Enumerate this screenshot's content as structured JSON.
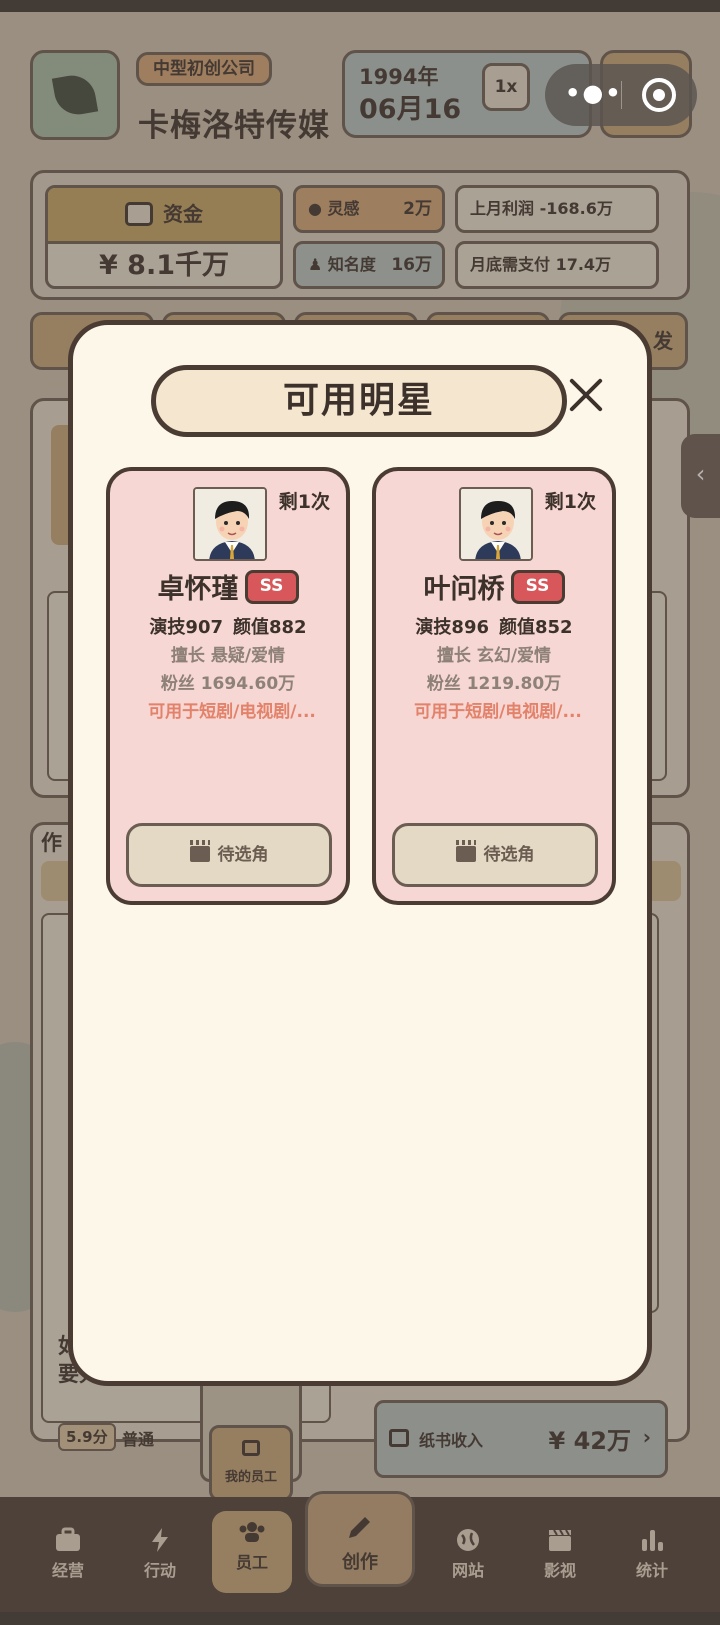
{
  "company": {
    "badge": "中型初创公司",
    "name": "卡梅洛特传媒",
    "year": "1994年",
    "date": "06月16",
    "speed": "1x"
  },
  "stats": {
    "funds_label": "资金",
    "funds_value": "¥ 8.1千万",
    "inspiration_label": "灵感",
    "inspiration_value": "2万",
    "fame_label": "知名度",
    "fame_value": "16万",
    "last_profit": "上月利润 -168.6万",
    "month_end_pay": "月底需支付 17.4万"
  },
  "background": {
    "partial_right": "发",
    "works_title": "作",
    "text_line_1": "如",
    "text_line_2": "要先养一养了。",
    "score_tag": "5.9分",
    "score_level": "普通",
    "paper_income_label": "纸书收入",
    "paper_income_value": "¥ 42万",
    "my_staff": "我的员工"
  },
  "modal": {
    "title": "可用明星",
    "stars": [
      {
        "remaining": "剩1次",
        "name": "卓怀瑾",
        "grade": "SS",
        "acting": "演技907",
        "looks": "颜值882",
        "specialty": "擅长 悬疑/爱情",
        "fans": "粉丝 1694.60万",
        "usage": "可用于短剧/电视剧/...",
        "button": "待选角"
      },
      {
        "remaining": "剩1次",
        "name": "叶问桥",
        "grade": "SS",
        "acting": "演技896",
        "looks": "颜值852",
        "specialty": "擅长 玄幻/爱情",
        "fans": "粉丝 1219.80万",
        "usage": "可用于短剧/电视剧/...",
        "button": "待选角"
      }
    ]
  },
  "nav": {
    "items": [
      {
        "label": "经营",
        "icon": "briefcase-icon"
      },
      {
        "label": "行动",
        "icon": "lightning-icon"
      },
      {
        "label": "员工",
        "icon": "people-icon"
      },
      {
        "label": "创作",
        "icon": "pen-icon"
      },
      {
        "label": "网站",
        "icon": "globe-icon"
      },
      {
        "label": "影视",
        "icon": "clapperboard-icon"
      },
      {
        "label": "统计",
        "icon": "bar-chart-icon"
      }
    ],
    "active": "员工"
  },
  "colors": {
    "accent": "#c9a97b",
    "card_bg": "#f6d7d3",
    "grade_badge": "#d8575a",
    "usage_text": "#e3826a"
  }
}
